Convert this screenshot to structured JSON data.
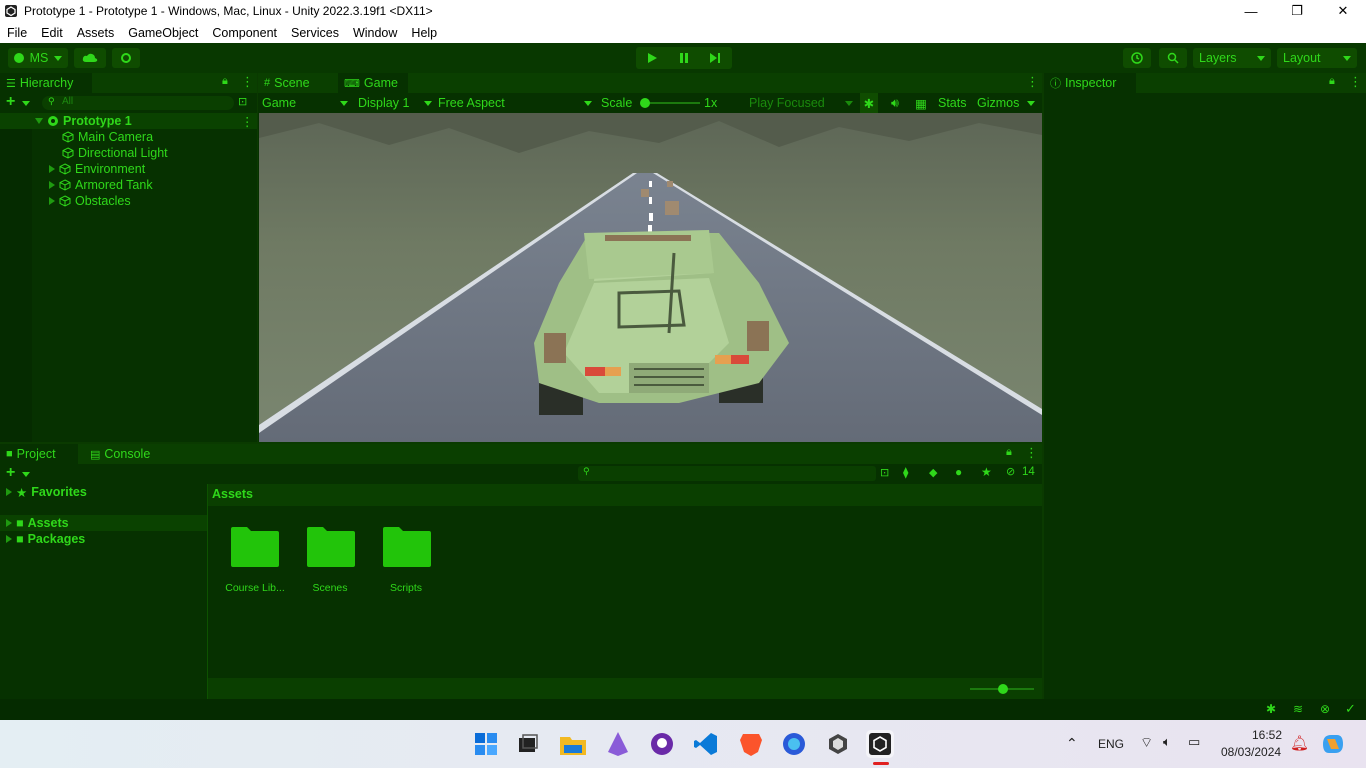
{
  "window": {
    "title": "Prototype 1 - Prototype 1 - Windows, Mac, Linux - Unity 2022.3.19f1 <DX11>",
    "minimize": "—",
    "maximize": "❐",
    "close": "✕"
  },
  "menu": [
    "File",
    "Edit",
    "Assets",
    "GameObject",
    "Component",
    "Services",
    "Window",
    "Help"
  ],
  "toolbar": {
    "account": "MS",
    "layers": "Layers",
    "layout": "Layout"
  },
  "hierarchy": {
    "tab": "Hierarchy",
    "search_placeholder": "All",
    "scene": "Prototype 1",
    "items": [
      {
        "label": "Main Camera",
        "expandable": false
      },
      {
        "label": "Directional Light",
        "expandable": false
      },
      {
        "label": "Environment",
        "expandable": true
      },
      {
        "label": "Armored Tank",
        "expandable": true
      },
      {
        "label": "Obstacles",
        "expandable": true
      }
    ]
  },
  "viewtabs": {
    "scene": "Scene",
    "game": "Game"
  },
  "gamebar": {
    "mode": "Game",
    "display": "Display 1",
    "aspect": "Free Aspect",
    "scale_label": "Scale",
    "scale_value": "1x",
    "play_focused": "Play Focused",
    "stats": "Stats",
    "gizmos": "Gizmos"
  },
  "inspector": {
    "tab": "Inspector"
  },
  "project": {
    "tab_project": "Project",
    "tab_console": "Console",
    "hidden_count": "14",
    "tree": [
      "Favorites",
      "Assets",
      "Packages"
    ],
    "breadcrumb": "Assets",
    "folders": [
      "Course Lib...",
      "Scenes",
      "Scripts"
    ]
  },
  "taskbar": {
    "lang": "ENG",
    "time": "16:52",
    "date": "08/03/2024"
  },
  "colors": {
    "accent": "#2fd81a",
    "panel": "#063100",
    "folder": "#22c40a"
  }
}
